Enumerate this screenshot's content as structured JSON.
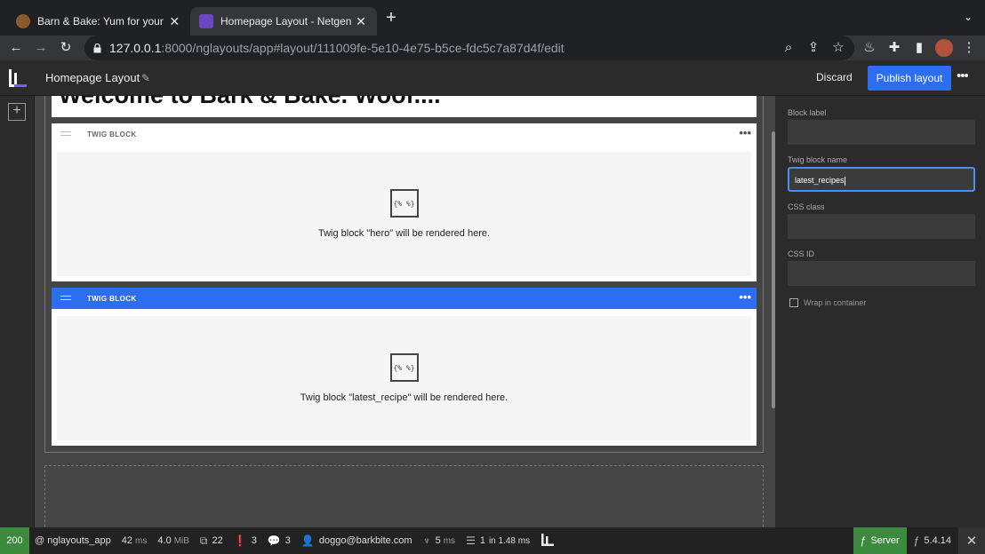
{
  "browser": {
    "tabs": [
      {
        "title": "Barn & Bake: Yum for your Pup",
        "favicon_color": "#8b5a2b"
      },
      {
        "title": "Homepage Layout - Netgen La",
        "favicon_color": "#6b46c1"
      }
    ],
    "new_tab_label": "+",
    "url": {
      "host": "127.0.0.1",
      "rest": ":8000/nglayouts/app#layout/111009fe-5e10-4e75-b5ce-fdc5c7a87d4f/edit"
    }
  },
  "app": {
    "layout_title": "Homepage Layout",
    "discard_label": "Discard",
    "publish_label": "Publish layout",
    "accent": "#2d6ef0",
    "canvas": {
      "heading_text": "Welcome to Bark & Bake. Woof....",
      "blocks": [
        {
          "type_label": "TWIG BLOCK",
          "icon_text": "{% %}",
          "render_text": "Twig block \"hero\" will be rendered here."
        },
        {
          "type_label": "TWIG BLOCK",
          "icon_text": "{% %}",
          "render_text": "Twig block \"latest_recipe\" will be rendered here."
        }
      ]
    },
    "panel": {
      "block_label": {
        "label": "Block label",
        "value": ""
      },
      "twig_block_name": {
        "label": "Twig block name",
        "value": "latest_recipes"
      },
      "css_class": {
        "label": "CSS class",
        "value": ""
      },
      "css_id": {
        "label": "CSS ID",
        "value": ""
      },
      "wrap_label": "Wrap in container",
      "wrap_checked": false
    }
  },
  "status": {
    "code": "200",
    "route": "@ nglayouts_app",
    "time_value": "42",
    "time_unit": "ms",
    "memory_value": "4.0",
    "memory_unit": "MiB",
    "forms": "22",
    "validator": "3",
    "translations": "3",
    "user": "doggo@barkbite.com",
    "render_value": "5",
    "render_unit": "ms",
    "db_queries": "1",
    "db_time": "in 1.48 ms",
    "server_label": "Server",
    "symfony_version": "5.4.14",
    "code_color": "#3b8a3e"
  }
}
